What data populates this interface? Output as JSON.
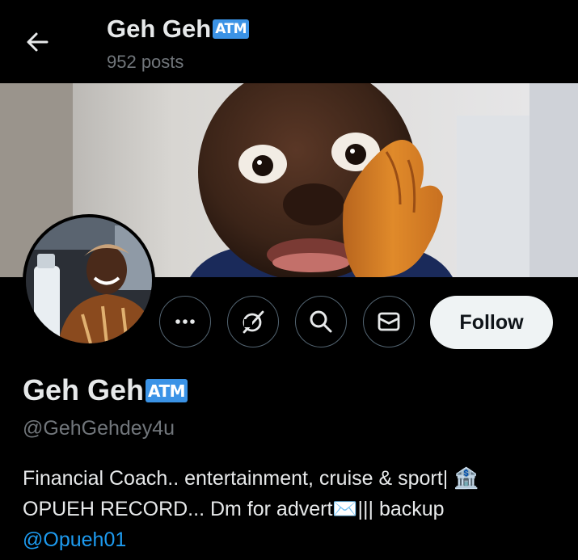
{
  "header": {
    "name": "Geh Geh",
    "badge": "ATM",
    "posts": "952 posts"
  },
  "profile": {
    "name": "Geh Geh",
    "badge": "ATM",
    "handle": "@GehGehdey4u",
    "bio_line1": "Financial Coach.. entertainment, cruise & sport| 🏦",
    "bio_line2": "OPUEH RECORD... Dm for advert✉️||| backup",
    "bio_mention": "@Opueh01"
  },
  "actions": {
    "follow_label": "Follow"
  },
  "icons": {
    "back": "arrow-left-icon",
    "more": "more-dots-icon",
    "grok": "grok-icon",
    "search": "search-icon",
    "message": "envelope-icon"
  },
  "colors": {
    "background": "#000000",
    "text": "#e7e9ea",
    "muted": "#71767b",
    "link": "#1d9bf0",
    "badge": "#3b93e6",
    "follow_bg": "#eff3f4"
  }
}
